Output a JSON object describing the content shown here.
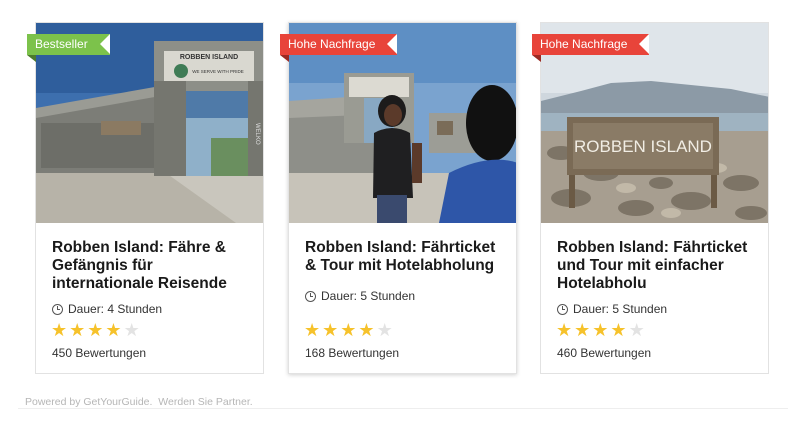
{
  "cards": [
    {
      "badge": "Bestseller",
      "badge_color": "#7cc24b",
      "title": "Robben Island: Fähre & Gefängnis für internationale Reisende",
      "duration": "Dauer: 4 Stunden",
      "rating": 4,
      "rating_max": 5,
      "reviews": "450 Bewertungen"
    },
    {
      "badge": "Hohe Nachfrage",
      "badge_color": "#e8443a",
      "title": "Robben Island: Fährticket & Tour mit Hotelabholung",
      "duration": "Dauer: 5 Stunden",
      "rating": 4,
      "rating_max": 5,
      "reviews": "168 Bewertungen"
    },
    {
      "badge": "Hohe Nachfrage",
      "badge_color": "#e8443a",
      "title": "Robben Island: Fährticket und Tour mit einfacher Hotelabholu",
      "duration": "Dauer: 5 Stunden",
      "rating": 4,
      "rating_max": 5,
      "reviews": "460 Bewertungen"
    }
  ],
  "footer": {
    "powered_by": "Powered by GetYourGuide.",
    "partner_link": "Werden Sie Partner."
  },
  "images": {
    "gate_sign": "ROBBEN ISLAND",
    "gate_motto": "WE SERVE WITH PRIDE",
    "rock_sign": "ROBBEN ISLAND"
  },
  "colors": {
    "star_on": "#f6c22b",
    "star_off": "#e3e3e3",
    "accent_green": "#7cc24b",
    "accent_red": "#e8443a"
  }
}
